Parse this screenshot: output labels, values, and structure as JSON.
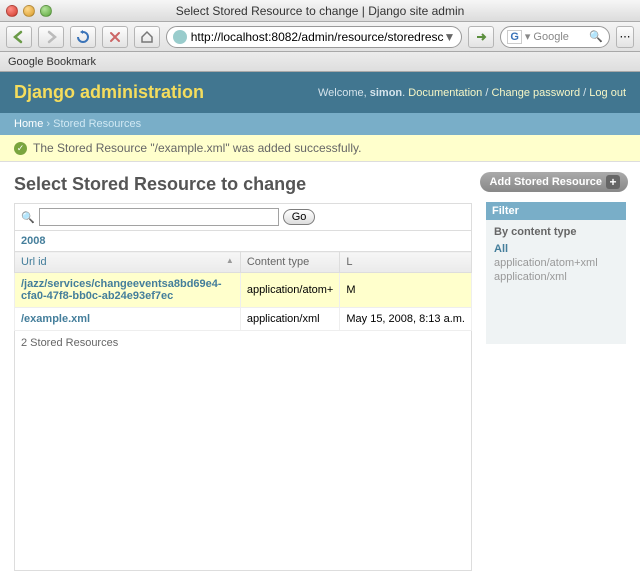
{
  "browser": {
    "title": "Select Stored Resource to change | Django site admin",
    "url": "http://localhost:8082/admin/resource/storedresc",
    "search_placeholder": "Google",
    "search_engine": "G",
    "bookmark": "Google Bookmark"
  },
  "header": {
    "branding": "Django administration",
    "welcome": "Welcome,",
    "user": "simon",
    "doc": "Documentation",
    "chpwd": "Change password",
    "logout": "Log out"
  },
  "breadcrumbs": {
    "home": "Home",
    "current": "Stored Resources"
  },
  "message": "The Stored Resource \"/example.xml\" was added successfully.",
  "title": "Select Stored Resource to change",
  "add_button": "Add Stored Resource",
  "search": {
    "go": "Go"
  },
  "date_hierarchy": "2008",
  "columns": {
    "url": "Url id",
    "ct": "Content type",
    "lm": "L"
  },
  "rows": [
    {
      "url": "/jazz/services/changeeventsa8bd69e4-cfa0-47f8-bb0c-ab24e93ef7ec",
      "ct": "application/atom+",
      "lm": "M"
    },
    {
      "url": "/example.xml",
      "ct": "application/xml",
      "lm": "May 15, 2008, 8:13 a.m."
    }
  ],
  "count": "2 Stored Resources",
  "filter": {
    "heading": "Filter",
    "title": "By content type",
    "options": [
      "All",
      "application/atom+xml",
      "application/xml"
    ]
  }
}
